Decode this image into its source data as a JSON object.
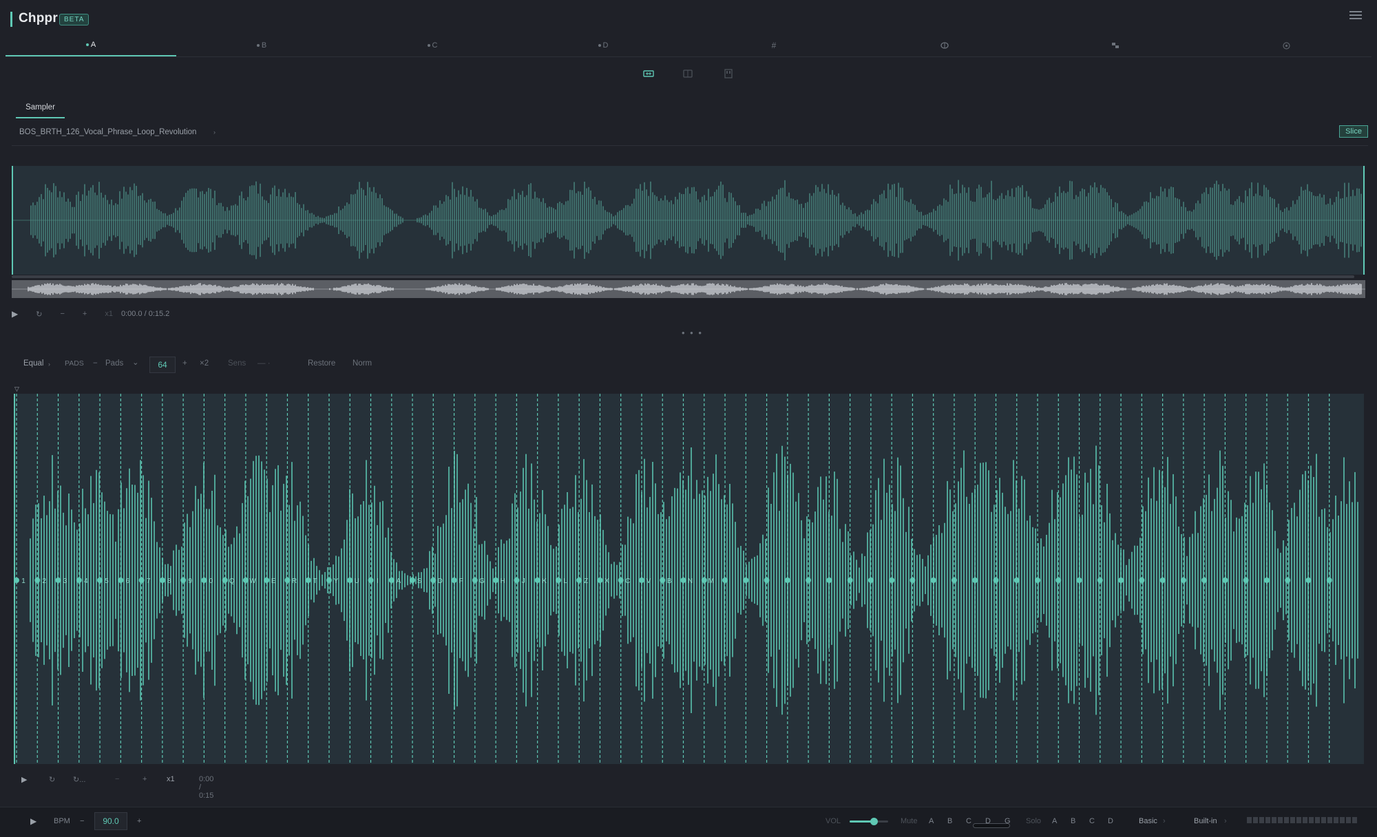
{
  "app": {
    "title": "Chppr",
    "badge": "BETA"
  },
  "tabs": [
    {
      "label": "A",
      "icon": "dot",
      "active": true
    },
    {
      "label": "B",
      "icon": "dot",
      "active": false
    },
    {
      "label": "C",
      "icon": "dot",
      "active": false
    },
    {
      "label": "D",
      "icon": "dot",
      "active": false
    },
    {
      "label": "",
      "icon": "grid-hash-icon",
      "active": false
    },
    {
      "label": "",
      "icon": "brain-icon",
      "active": false
    },
    {
      "label": "",
      "icon": "patch-icon",
      "active": false
    },
    {
      "label": "",
      "icon": "settings-circle-icon",
      "active": false
    }
  ],
  "view_icons": [
    "waveform-view-icon",
    "pads-view-icon",
    "sequence-view-icon"
  ],
  "sampler": {
    "tab_label": "Sampler",
    "file_name": "BOS_BRTH_126_Vocal_Phrase_Loop_Revolution",
    "file_chevron": "›",
    "slice_button": "Slice"
  },
  "overview_player": {
    "play": "▶",
    "loop": "↻",
    "minus": "−",
    "plus": "+",
    "speed": "x1",
    "time": "0:00.0 / 0:15.2"
  },
  "divider": "• • •",
  "slice_toolbar": {
    "mode": "Equal",
    "mode_chevron": "›",
    "pads_caption": "PADS",
    "pads_minus": "−",
    "pads_label": "Pads",
    "pads_chevron": "⌄",
    "count": "64",
    "plus": "+",
    "times2": "×2",
    "sens": "Sens",
    "sens_dash": "— ·",
    "restore": "Restore",
    "norm": "Norm"
  },
  "slice_marker": "▽",
  "slice_labels": [
    "1",
    "2",
    "3",
    "4",
    "5",
    "6",
    "7",
    "8",
    "9",
    "0",
    "Q",
    "W",
    "E",
    "R",
    "T",
    "Y",
    "U",
    "I",
    "A",
    "S",
    "D",
    "F",
    "G",
    "H",
    "J",
    "K",
    "L",
    "Z",
    "X",
    "C",
    "V",
    "B",
    "N",
    "M"
  ],
  "slice_count": 64,
  "main_player": {
    "play": "▶",
    "loop": "↻",
    "loop_label": "↻...",
    "minus": "−",
    "plus": "+",
    "speed": "x1",
    "time": "0:00 / 0:15"
  },
  "bottom": {
    "play": "▶",
    "bpm_label": "BPM",
    "bpm_minus": "−",
    "bpm_value": "90.0",
    "bpm_plus": "+",
    "vol_label": "VOL",
    "volume": 0.62,
    "mute_label": "Mute",
    "mute_channels": [
      "A",
      "B",
      "C",
      "D",
      "G"
    ],
    "solo_label": "Solo",
    "solo_channels": [
      "A",
      "B",
      "C",
      "D"
    ],
    "preset": "Basic",
    "preset_chevron": "›",
    "output": "Built-in",
    "output_chevron": "›"
  },
  "colors": {
    "accent": "#5fc8b4",
    "background": "#1f2128",
    "wave_bg": "#263139"
  }
}
